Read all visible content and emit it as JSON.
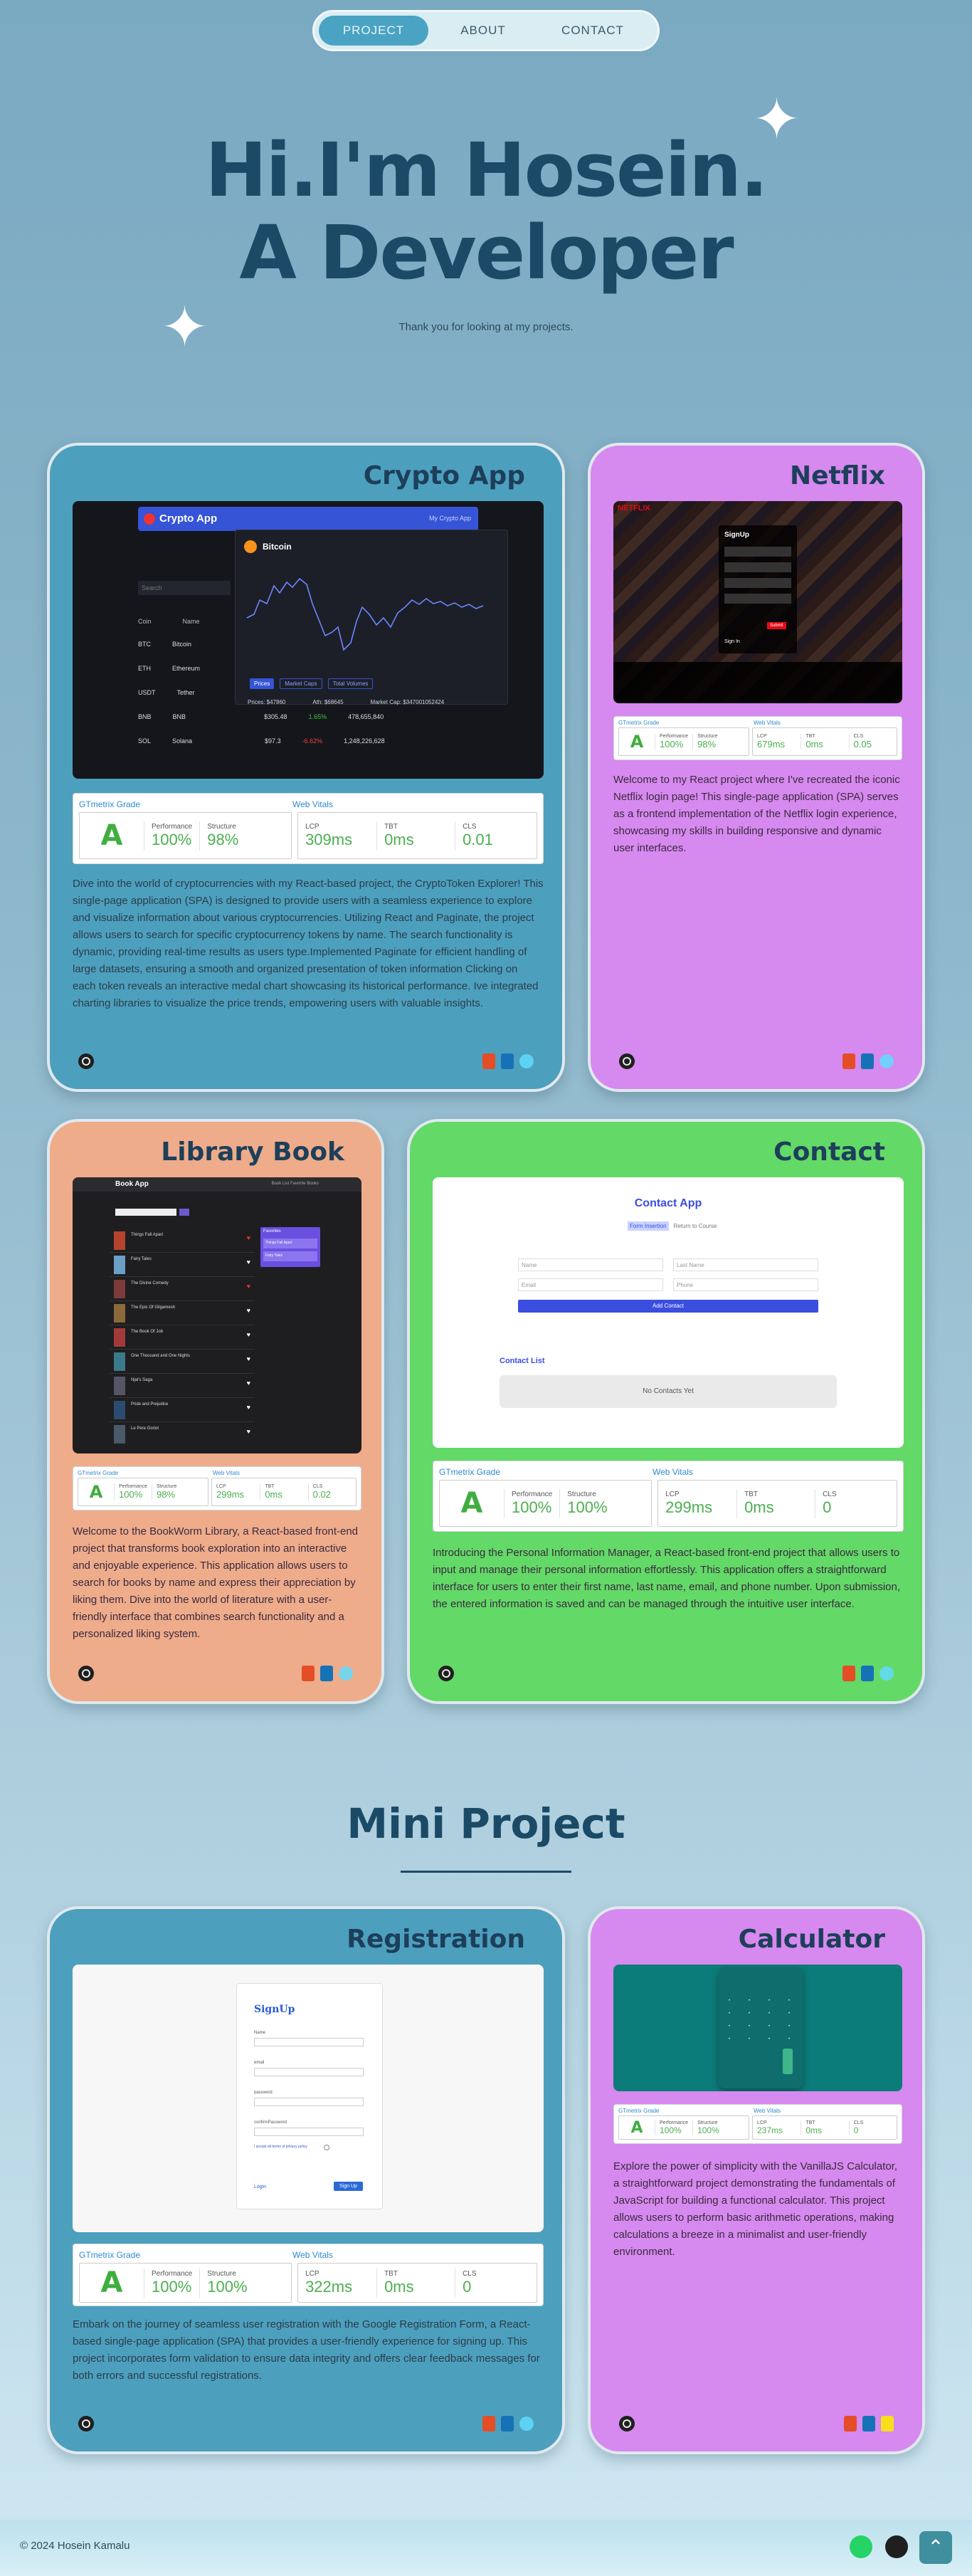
{
  "nav": {
    "items": [
      "PROJECT",
      "ABOUT",
      "CONTACT"
    ]
  },
  "hero": {
    "line1": "Hi.I'm Hosein.",
    "line2": "A Developer",
    "subtitle": "Thank you for looking at my projects."
  },
  "metric_labels": {
    "grade": "GTmetrix Grade",
    "vitals": "Web Vitals",
    "performance": "Performance",
    "structure": "Structure",
    "lcp": "LCP",
    "tbt": "TBT",
    "cls": "CLS"
  },
  "projects": [
    {
      "title": "Crypto App",
      "grade": "A",
      "performance": "100%",
      "structure": "98%",
      "lcp": "309ms",
      "tbt": "0ms",
      "cls": "0.01",
      "description": "Dive into the world of cryptocurrencies with my React-based project, the CryptoToken Explorer! This single-page application (SPA) is designed to provide users with a seamless experience to explore and visualize information about various cryptocurrencies. Utilizing React and Paginate, the project allows users to search for specific cryptocurrency tokens by name. The search functionality is dynamic, providing real-time results as users type.Implemented Paginate for efficient handling of large datasets, ensuring a smooth and organized presentation of token information Clicking on each token reveals an interactive medal chart showcasing its historical performance. Ive integrated charting libraries to visualize the price trends, empowering users with valuable insights.",
      "shot": {
        "app_title": "Crypto App",
        "tab": "My Crypto App",
        "coin": "Bitcoin",
        "search": "Search",
        "col_coin": "Coin",
        "col_name": "Name",
        "rows": [
          {
            "sym": "BTC",
            "name": "Bitcoin"
          },
          {
            "sym": "ETH",
            "name": "Ethereum"
          },
          {
            "sym": "USDT",
            "name": "Tether"
          },
          {
            "sym": "BNB",
            "name": "BNB",
            "price": "$305.48",
            "chg": "1.65%",
            "cap": "478,655,840"
          },
          {
            "sym": "SOL",
            "name": "Solana",
            "price": "$97.3",
            "chg": "-6.62%",
            "cap": "1,248,226,628"
          }
        ],
        "buttons": [
          "Prices",
          "Market Caps",
          "Total Volumes"
        ],
        "stats": {
          "price": "Prices: $47860",
          "ath": "Ath: $68645",
          "cap": "Market Cap: $347001052424"
        }
      }
    },
    {
      "title": "Netflix",
      "grade": "A",
      "performance": "100%",
      "structure": "98%",
      "lcp": "679ms",
      "tbt": "0ms",
      "cls": "0.05",
      "description": "Welcome to my React project where I've recreated the iconic Netflix login page! This single-page application (SPA) serves as a frontend implementation of the Netflix login experience, showcasing my skills in building responsive and dynamic user interfaces.",
      "shot": {
        "brand": "NETFLIX",
        "form_title": "SignUp",
        "btn": "Submit",
        "login": "Sign In"
      }
    },
    {
      "title": "Library Book",
      "grade": "A",
      "performance": "100%",
      "structure": "98%",
      "lcp": "299ms",
      "tbt": "0ms",
      "cls": "0.02",
      "description": "Welcome to the BookWorm Library, a React-based front-end project that transforms book exploration into an interactive and enjoyable experience. This application allows users to search for books by name and express their appreciation by liking them. Dive into the world of literature with a user-friendly interface that combines search functionality and a personalized liking system.",
      "shot": {
        "app_title": "Book App",
        "nav_links": "Book List  Favorite Books",
        "favorites": "Favorites",
        "fav_items": [
          "Things Fall Apart",
          "Fairy Tales"
        ],
        "books": [
          "Things Fall Apart",
          "Fairy Tales",
          "The Divine Comedy",
          "The Epic Of Gilgamesh",
          "The Book Of Job",
          "One Thousand and One Nights",
          "Njal's Saga",
          "Pride and Prejudice",
          "Le Pere Goriot"
        ]
      }
    },
    {
      "title": "Contact",
      "grade": "A",
      "performance": "100%",
      "structure": "100%",
      "lcp": "299ms",
      "tbt": "0ms",
      "cls": "0",
      "description": "Introducing the Personal Information Manager, a React-based front-end project that allows users to input and manage their personal information effortlessly. This application offers a straightforward interface for users to enter their first name, last name, email, and phone number. Upon submission, the entered information is saved and can be managed through the intuitive user interface.",
      "shot": {
        "app_title": "Contact App",
        "tabs": [
          "Form Insertion",
          "Return to Course"
        ],
        "fields": [
          "Name",
          "Last Name",
          "Email",
          "Phone"
        ],
        "add_btn": "Add Contact",
        "list_title": "Contact List",
        "empty": "No Contacts Yet"
      }
    }
  ],
  "mini": {
    "title": "Mini Project",
    "projects": [
      {
        "title": "Registration",
        "grade": "A",
        "performance": "100%",
        "structure": "100%",
        "lcp": "322ms",
        "tbt": "0ms",
        "cls": "0",
        "description": "Embark on the journey of seamless user registration with the Google Registration Form, a React-based single-page application (SPA) that provides a user-friendly experience for signing up. This project incorporates form validation to ensure data integrity and offers clear feedback messages for both errors and successful registrations.",
        "shot": {
          "form_title": "SignUp",
          "fields": [
            "Name",
            "email",
            "password",
            "confirmPassword"
          ],
          "accept": "I accept all terms of privacy policy",
          "login": "Login",
          "signup": "Sign Up"
        }
      },
      {
        "title": "Calculator",
        "grade": "A",
        "performance": "100%",
        "structure": "100%",
        "lcp": "237ms",
        "tbt": "0ms",
        "cls": "0",
        "description": "Explore the power of simplicity with the VanillaJS Calculator, a straightforward project demonstrating the fundamentals of JavaScript for building a functional calculator. This project allows users to perform basic arithmetic operations, making calculations a breeze in a minimalist and user-friendly environment."
      }
    ]
  },
  "footer": {
    "copyright": "© 2024 Hosein Kamalu",
    "up_icon": "arrow-up-icon"
  },
  "colors": {
    "blue_card": "#4d9fbe",
    "purple_card": "#d689ee",
    "peach_card": "#eeac8b",
    "green_card": "#63d967",
    "title": "#1b4a66"
  }
}
